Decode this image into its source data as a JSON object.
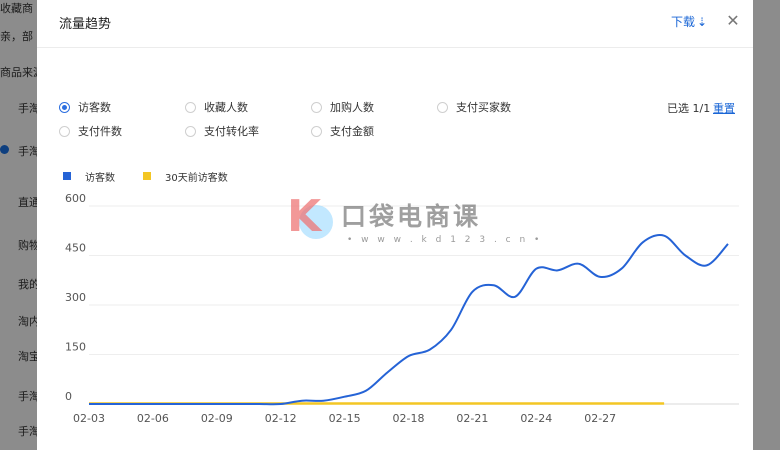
{
  "background": {
    "items": [
      "收藏商",
      "亲，部",
      "商品来源",
      "手淘",
      "手淘",
      "直通",
      "购物",
      "我的",
      "淘内",
      "淘宝",
      "手淘",
      "手淘"
    ]
  },
  "modal": {
    "title": "流量趋势",
    "download_label": "下载",
    "download_icon": "download-arrow-icon",
    "close_icon": "close-icon"
  },
  "metrics": [
    {
      "label": "访客数",
      "selected": true
    },
    {
      "label": "收藏人数",
      "selected": false
    },
    {
      "label": "加购人数",
      "selected": false
    },
    {
      "label": "支付买家数",
      "selected": false
    },
    {
      "label": "支付件数",
      "selected": false
    },
    {
      "label": "支付转化率",
      "selected": false
    },
    {
      "label": "支付金额",
      "selected": false
    }
  ],
  "selection": {
    "count_text": "已选 1/1",
    "reset_label": "重置"
  },
  "colors": {
    "accent": "#1a66d6",
    "series_current": "#2563d6",
    "series_previous": "#f3c624"
  },
  "watermark": {
    "text": "口袋电商课",
    "url": "• w w w . k d 1 2 3 . c n •"
  },
  "chart_data": {
    "type": "line",
    "ylim": [
      0,
      600
    ],
    "yticks": [
      "600",
      "450",
      "300",
      "150",
      "0"
    ],
    "x_tick_labels": [
      "02-03",
      "02-06",
      "02-09",
      "02-12",
      "02-15",
      "02-18",
      "02-21",
      "02-24",
      "02-27"
    ],
    "x": [
      "02-03",
      "02-04",
      "02-05",
      "02-06",
      "02-07",
      "02-08",
      "02-09",
      "02-10",
      "02-11",
      "02-12",
      "02-13",
      "02-14",
      "02-15",
      "02-16",
      "02-17",
      "02-18",
      "02-19",
      "02-20",
      "02-21",
      "02-22",
      "02-23",
      "02-24",
      "02-25",
      "02-26",
      "02-27",
      "02-28",
      "03-01",
      "03-02",
      "03-03",
      "03-04"
    ],
    "series": [
      {
        "name": "访客数",
        "values": [
          0,
          0,
          0,
          0,
          0,
          0,
          0,
          0,
          0,
          0,
          10,
          10,
          22,
          40,
          95,
          145,
          165,
          225,
          340,
          360,
          325,
          410,
          405,
          425,
          385,
          410,
          490,
          510,
          450,
          420,
          485
        ]
      },
      {
        "name": "30天前访客数",
        "values": [
          0,
          0,
          0,
          0,
          0,
          0,
          0,
          0,
          0,
          0,
          0,
          0,
          0,
          0,
          0,
          0,
          0,
          0,
          0,
          0,
          0,
          0,
          0,
          0,
          0,
          0,
          0,
          0
        ]
      }
    ]
  }
}
